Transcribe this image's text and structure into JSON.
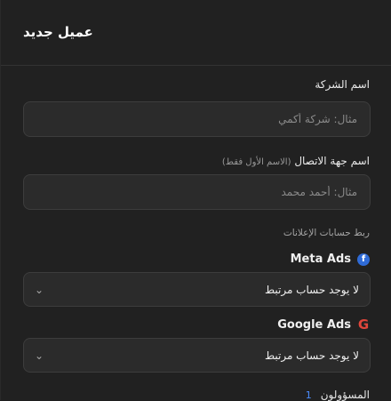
{
  "dialog": {
    "title": "عميل جديد"
  },
  "company": {
    "label": "اسم الشركة",
    "placeholder": "مثال: شركة أكمي",
    "value": ""
  },
  "contact": {
    "label": "اسم جهة الاتصال",
    "hint": "(الاسم الأول فقط)",
    "placeholder": "مثال: أحمد محمد",
    "value": ""
  },
  "ads_section": {
    "label": "ربط حسابات الإعلانات"
  },
  "meta": {
    "name": "Meta Ads",
    "icon": "facebook-icon",
    "selected": "لا يوجد حساب مرتبط"
  },
  "google": {
    "name": "Google Ads",
    "icon": "google-icon",
    "selected": "لا يوجد حساب مرتبط"
  },
  "responsible": {
    "label": "المسؤولون",
    "count": "1"
  },
  "colors": {
    "background": "#212121",
    "field": "#2b2b2b",
    "facebook": "#2f6bd6",
    "google": "#e0463b",
    "accent": "#4c8dff"
  }
}
